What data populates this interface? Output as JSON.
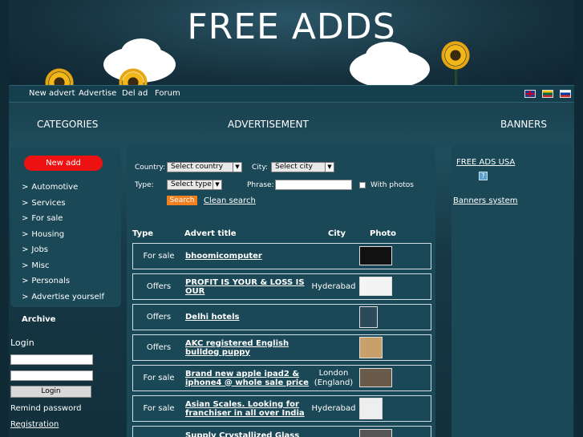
{
  "site": {
    "title": "FREE ADDS"
  },
  "nav": {
    "items": [
      {
        "label": "New advert"
      },
      {
        "label": "Advertise"
      },
      {
        "label": "Del ad"
      },
      {
        "label": "Forum"
      }
    ],
    "flags": [
      {
        "name": "english-flag-icon"
      },
      {
        "name": "lithuanian-flag-icon"
      },
      {
        "name": "russian-flag-icon"
      }
    ]
  },
  "sections": {
    "categories": "CATEGORIES",
    "advertisement": "ADVERTISEMENT",
    "banners": "BANNERS"
  },
  "left": {
    "new_add": "New add",
    "categories": [
      {
        "label": "Automotive"
      },
      {
        "label": "Services"
      },
      {
        "label": "For sale"
      },
      {
        "label": "Housing"
      },
      {
        "label": "Jobs"
      },
      {
        "label": "Misc"
      },
      {
        "label": "Personals"
      },
      {
        "label": "Advertise yourself"
      }
    ],
    "archive": "Archive",
    "login_label": "Login",
    "login_button": "Login",
    "remind": "Remind password",
    "registration": "Registration"
  },
  "search": {
    "country_label": "Country:",
    "country_value": "Select country",
    "city_label": "City:",
    "city_value": "Select city",
    "type_label": "Type:",
    "type_value": "Select type",
    "phrase_label": "Phrase:",
    "phrase_value": "",
    "photos_label": "With photos",
    "search_button": "Search",
    "clean_link": "Clean search"
  },
  "table": {
    "headers": {
      "type": "Type",
      "title": "Advert title",
      "city": "City",
      "photo": "Photo"
    },
    "rows": [
      {
        "type": "For sale",
        "title": "bhoomicomputer",
        "city": ""
      },
      {
        "type": "Offers",
        "title": "PROFIT IS YOUR & LOSS IS OUR",
        "city": "Hyderabad"
      },
      {
        "type": "Offers",
        "title": "Delhi hotels",
        "city": ""
      },
      {
        "type": "Offers",
        "title": "AKC registered English bulldog puppy",
        "city": ""
      },
      {
        "type": "For sale",
        "title": "Brand new apple ipad2 & iphone4 @ whole sale price",
        "city": "London (England)"
      },
      {
        "type": "For sale",
        "title": "Asian Scales. Looking for franchiser in all over India",
        "city": "Hyderabad"
      },
      {
        "type": "",
        "title": "Supply Crystallized Glass",
        "city": ""
      }
    ]
  },
  "right": {
    "free_ads_usa": "FREE ADS USA",
    "banners_system": "Banners system"
  },
  "colors": {
    "new_add_button": "#ee1111",
    "search_button": "#f08020",
    "panel": "#1b4856"
  }
}
